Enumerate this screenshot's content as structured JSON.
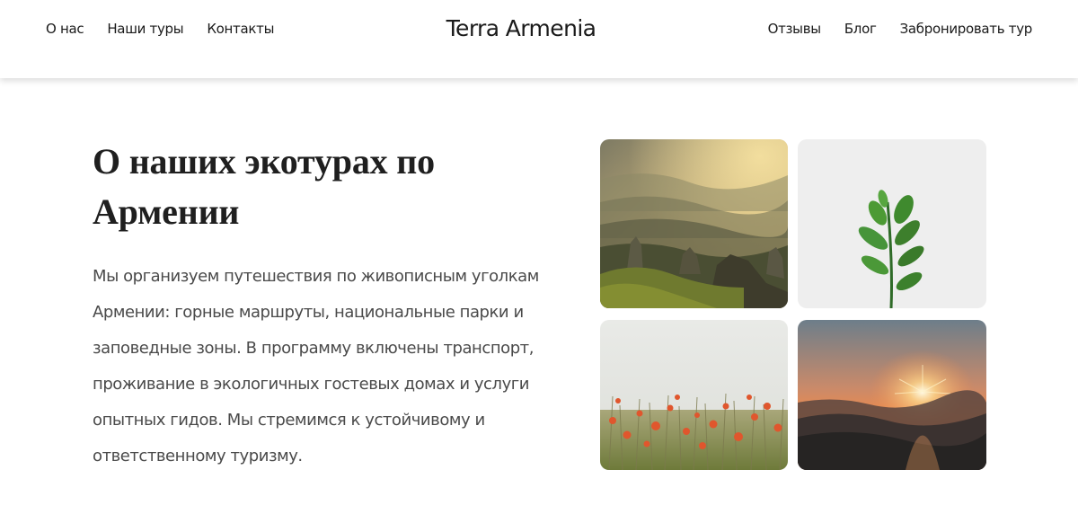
{
  "header": {
    "logo": "Terra Armenia",
    "nav_left": [
      "О нас",
      "Наши туры",
      "Контакты"
    ],
    "nav_right": [
      "Отзывы",
      "Блог",
      "Забронировать тур"
    ]
  },
  "about": {
    "heading": "О наших экотурах по Армении",
    "paragraph": "Мы организуем путешествия по живописным уголкам Армении: горные маршруты, национальные парки и заповедные зоны. В программу включены транспорт, проживание в экологичных гостевых домах и услуги опытных гидов. Мы стремимся к устойчивому и ответственному туризму."
  },
  "gallery": {
    "images": [
      "mountain-valley-photo",
      "green-sprout-photo",
      "poppy-field-photo",
      "mountain-sunset-photo"
    ]
  }
}
